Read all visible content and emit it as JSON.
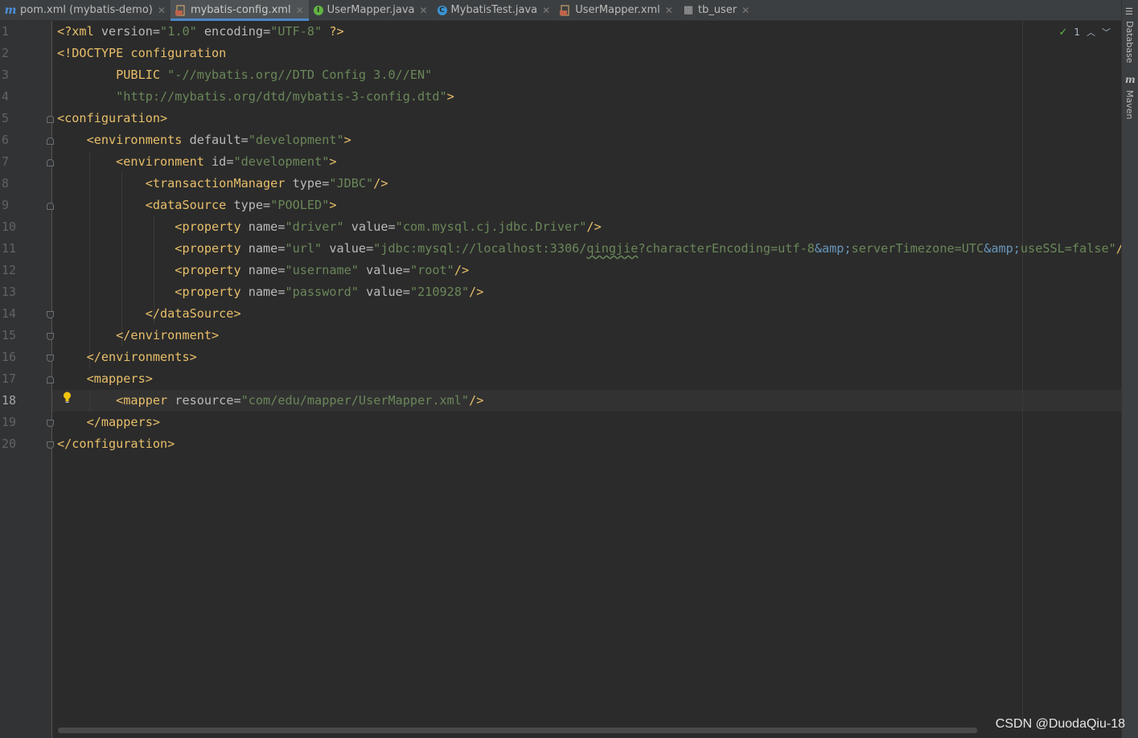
{
  "tabs": [
    {
      "label": "pom.xml (mybatis-demo)",
      "icon": "maven-icon",
      "active": false
    },
    {
      "label": "mybatis-config.xml",
      "icon": "xml-file-icon",
      "active": true
    },
    {
      "label": "UserMapper.java",
      "icon": "interface-icon",
      "active": false
    },
    {
      "label": "MybatisTest.java",
      "icon": "class-icon",
      "active": false
    },
    {
      "label": "UserMapper.xml",
      "icon": "xml-file-icon",
      "active": false
    },
    {
      "label": "tb_user",
      "icon": "table-icon",
      "active": false
    }
  ],
  "right_strip": {
    "database": "Database",
    "maven": "Maven"
  },
  "inspection": {
    "count": "1"
  },
  "line_numbers": [
    "1",
    "2",
    "3",
    "4",
    "5",
    "6",
    "7",
    "8",
    "9",
    "10",
    "11",
    "12",
    "13",
    "14",
    "15",
    "16",
    "17",
    "18",
    "19",
    "20"
  ],
  "current_line": "18",
  "code": {
    "l1": {
      "a": "<?xml ",
      "b": "version",
      "c": "=",
      "d": "\"1.0\"",
      "e": " encoding",
      "f": "=",
      "g": "\"UTF-8\"",
      "h": " ?>"
    },
    "l2": {
      "a": "<!DOCTYPE configuration"
    },
    "l3": {
      "a": "        PUBLIC ",
      "b": "\"-//mybatis.org//DTD Config 3.0//EN\""
    },
    "l4": {
      "a": "        ",
      "b": "\"http://mybatis.org/dtd/mybatis-3-config.dtd\"",
      "c": ">"
    },
    "l5": {
      "a": "<configuration>"
    },
    "l6": {
      "a": "    <environments ",
      "b": "default",
      "c": "=",
      "d": "\"development\"",
      "e": ">"
    },
    "l7": {
      "a": "        <environment ",
      "b": "id",
      "c": "=",
      "d": "\"development\"",
      "e": ">"
    },
    "l8": {
      "a": "            <transactionManager ",
      "b": "type",
      "c": "=",
      "d": "\"JDBC\"",
      "e": "/>"
    },
    "l9": {
      "a": "            <dataSource ",
      "b": "type",
      "c": "=",
      "d": "\"POOLED\"",
      "e": ">"
    },
    "l10": {
      "a": "                <property ",
      "b": "name",
      "c": "=",
      "d": "\"driver\"",
      "e": " value",
      "f": "=",
      "g": "\"com.mysql.cj.jdbc.Driver\"",
      "h": "/>"
    },
    "l11": {
      "a": "                <property ",
      "b": "name",
      "c": "=",
      "d": "\"url\"",
      "e": " value",
      "f": "=",
      "g1": "\"jdbc:mysql://localhost:3306/",
      "g2": "qingjie",
      "g3": "?characterEncoding=utf-8",
      "ent1": "&amp;",
      "g4": "serverTimezone=UTC",
      "ent2": "&amp;",
      "g5": "useSSL=false\"",
      "h": "/>"
    },
    "l12": {
      "a": "                <property ",
      "b": "name",
      "c": "=",
      "d": "\"username\"",
      "e": " value",
      "f": "=",
      "g": "\"root\"",
      "h": "/>"
    },
    "l13": {
      "a": "                <property ",
      "b": "name",
      "c": "=",
      "d": "\"password\"",
      "e": " value",
      "f": "=",
      "g": "\"210928\"",
      "h": "/>"
    },
    "l14": {
      "a": "            </dataSource>"
    },
    "l15": {
      "a": "        </environment>"
    },
    "l16": {
      "a": "    </environments>"
    },
    "l17": {
      "a": "    <mappers>"
    },
    "l18": {
      "a": "        <mapper ",
      "b": "resource",
      "c": "=",
      "d": "\"com/edu/mapper/UserMapper.xml\"",
      "e": "/>"
    },
    "l19": {
      "a": "    </mappers>"
    },
    "l20": {
      "a": "</configuration>"
    }
  },
  "watermark": "CSDN @DuodaQiu-18",
  "colors": {
    "tag": "#e8bf6a",
    "attr": "#bababa",
    "value": "#6a8759",
    "entity": "#6897bb",
    "background": "#2b2b2b"
  }
}
